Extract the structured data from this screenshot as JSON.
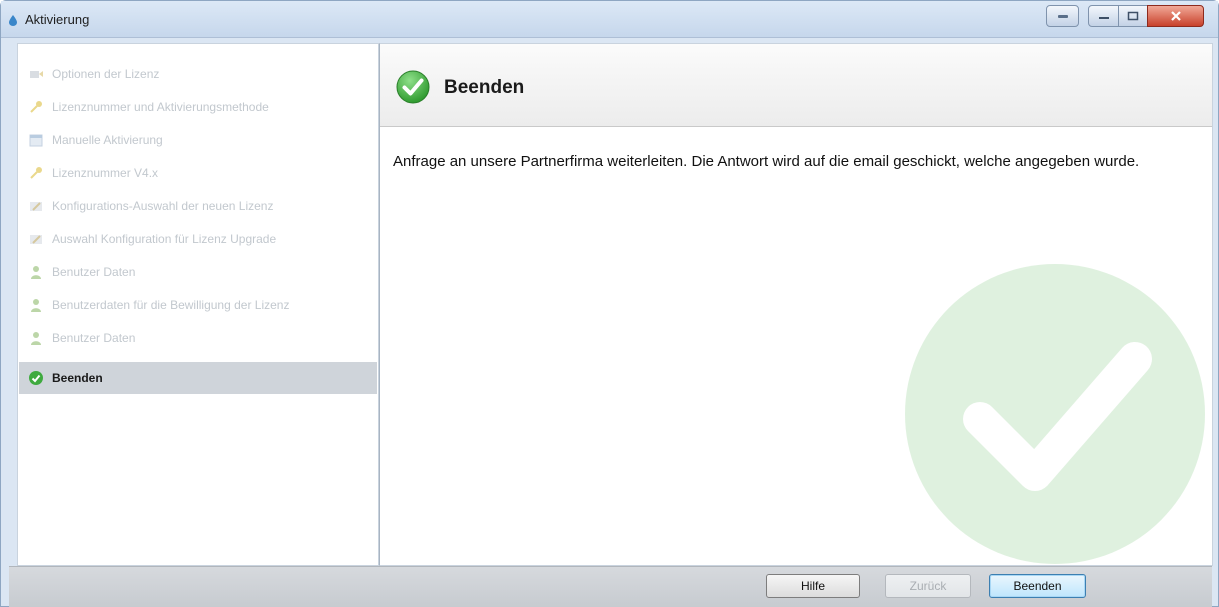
{
  "window": {
    "title": "Aktivierung",
    "icons": [
      "app-icon",
      "help-icon",
      "minimize-icon",
      "maximize-icon",
      "close-icon"
    ]
  },
  "steps": [
    {
      "label": "Optionen der Lizenz",
      "icon": "options-icon",
      "state": "disabled"
    },
    {
      "label": "Lizenznummer und Aktivierungsmethode",
      "icon": "key-icon",
      "state": "disabled"
    },
    {
      "label": "Manuelle Aktivierung",
      "icon": "calendar-icon",
      "state": "disabled"
    },
    {
      "label": "Lizenznummer V4.x",
      "icon": "key-icon",
      "state": "disabled"
    },
    {
      "label": "Konfigurations-Auswahl der neuen Lizenz",
      "icon": "configure-icon",
      "state": "disabled"
    },
    {
      "label": "Auswahl Konfiguration für Lizenz Upgrade",
      "icon": "configure-icon",
      "state": "disabled"
    },
    {
      "label": "Benutzer Daten",
      "icon": "user-icon",
      "state": "disabled"
    },
    {
      "label": "Benutzerdaten für die Bewilligung der Lizenz",
      "icon": "user-icon",
      "state": "disabled"
    },
    {
      "label": "Benutzer Daten",
      "icon": "user-icon",
      "state": "disabled"
    },
    {
      "label": "Beenden",
      "icon": "check-circle-icon",
      "state": "active"
    }
  ],
  "content": {
    "header_title": "Beenden",
    "header_icon": "check-circle-icon",
    "message": "Anfrage an unsere Partnerfirma weiterleiten. Die Antwort wird auf die email geschickt, welche angegeben wurde.",
    "watermark_icon": "check-circle-icon"
  },
  "footer": {
    "help_label": "Hilfe",
    "back_label": "Zurück",
    "finish_label": "Beenden"
  },
  "colors": {
    "accent_green": "#3faa3f",
    "active_step_bg": "#cfd4da",
    "close_button": "#c8412b",
    "default_button_border": "#3c7fb1"
  }
}
